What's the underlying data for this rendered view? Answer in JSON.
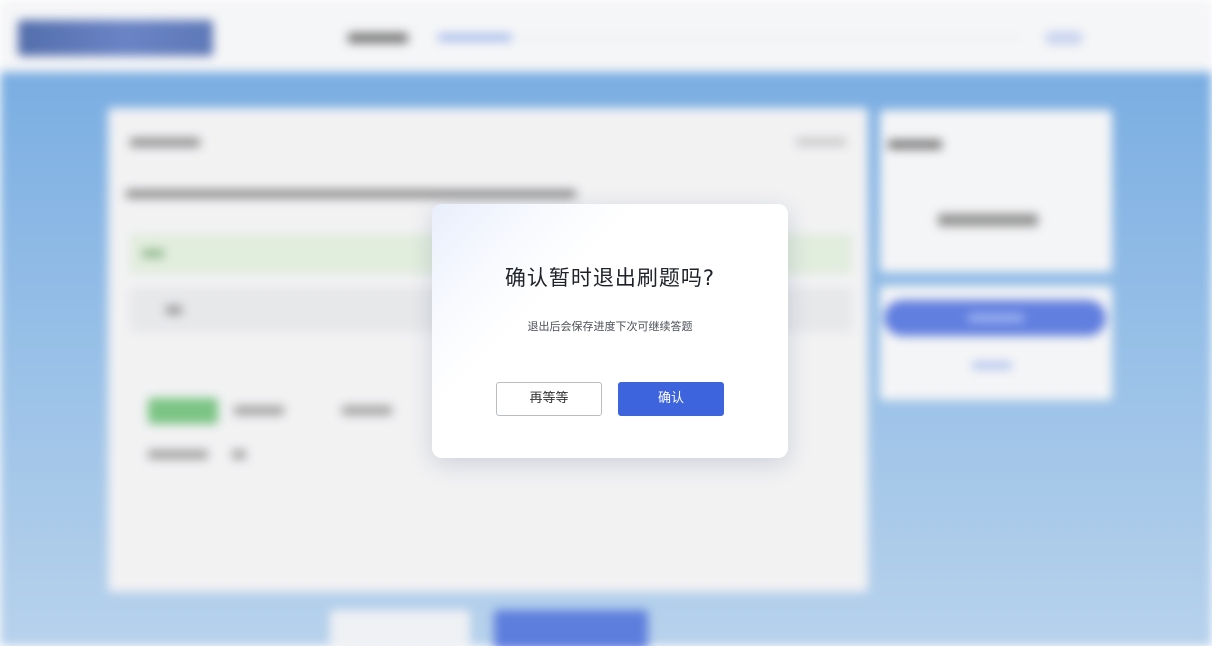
{
  "dialog": {
    "title": "确认暂时退出刷题吗?",
    "message": "退出后会保存进度下次可继续答题",
    "cancel_label": "再等等",
    "confirm_label": "确认"
  },
  "colors": {
    "primary": "#3d63dd",
    "background_blue": "#5e9cdc",
    "modal_bg": "#ffffff"
  },
  "background_state": "blurred-behind-modal"
}
